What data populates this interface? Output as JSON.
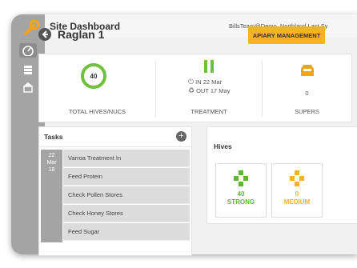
{
  "header": {
    "app_title": "Site Dashboard",
    "user": "BillsTeam@Demo_Northland  Last Sy"
  },
  "page": {
    "site_name": "Raglan 1",
    "apiary_button": "APIARY MANAGEMENT"
  },
  "stats": {
    "total": {
      "value": "40",
      "label": "TOTAL HIVES/NUCS"
    },
    "treatment": {
      "in_text": "IN 22 Mar",
      "out_text": "OUT 17 May",
      "label": "TREATMENT"
    },
    "supers": {
      "value": "0",
      "label": "SUPERS"
    }
  },
  "tasks": {
    "title": "Tasks",
    "add_icon": "+",
    "date": {
      "day": "22",
      "month": "Mar",
      "year": "18"
    },
    "items": [
      "Varroa Treatment In",
      "Feed Protein",
      "Check Pollen Stores",
      "Check Honey Stores",
      "Feed Sugar"
    ]
  },
  "hives": {
    "title": "Hives",
    "cards": [
      {
        "value": "40",
        "label": "STRONG",
        "color": "#5cb82e"
      },
      {
        "value": "0",
        "label": "MEDIUM",
        "color": "#f5b324"
      }
    ]
  },
  "colors": {
    "accent": "#f5b324",
    "green": "#70c03c",
    "sidebar": "#a4a4a4"
  }
}
